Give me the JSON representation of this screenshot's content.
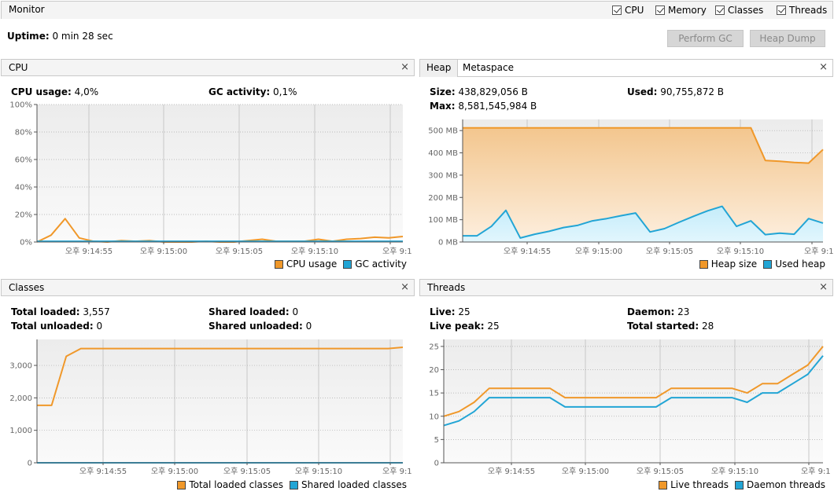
{
  "monitor": {
    "title": "Monitor",
    "checkboxes": [
      {
        "label": "CPU",
        "checked": true
      },
      {
        "label": "Memory",
        "checked": true
      },
      {
        "label": "Classes",
        "checked": true
      },
      {
        "label": "Threads",
        "checked": true
      }
    ],
    "uptime_label": "Uptime:",
    "uptime_value": "0 min 28 sec",
    "buttons": {
      "perform_gc": "Perform GC",
      "heap_dump": "Heap Dump"
    }
  },
  "cpu": {
    "title": "CPU",
    "close": "×",
    "usage_label": "CPU usage:",
    "usage_value": "4,0%",
    "gc_label": "GC activity:",
    "gc_value": "0,1%"
  },
  "heap": {
    "tabs": [
      "Heap",
      "Metaspace"
    ],
    "close": "×",
    "size_label": "Size:",
    "size_value": "438,829,056 B",
    "used_label": "Used:",
    "used_value": "90,755,872 B",
    "max_label": "Max:",
    "max_value": "8,581,545,984 B"
  },
  "classes": {
    "title": "Classes",
    "close": "×",
    "total_loaded_label": "Total loaded:",
    "total_loaded_value": "3,557",
    "total_unloaded_label": "Total unloaded:",
    "total_unloaded_value": "0",
    "shared_loaded_label": "Shared loaded:",
    "shared_loaded_value": "0",
    "shared_unloaded_label": "Shared unloaded:",
    "shared_unloaded_value": "0"
  },
  "threads": {
    "title": "Threads",
    "close": "×",
    "live_label": "Live:",
    "live_value": "25",
    "daemon_label": "Daemon:",
    "daemon_value": "23",
    "live_peak_label": "Live peak:",
    "live_peak_value": "25",
    "total_started_label": "Total started:",
    "total_started_value": "28"
  },
  "colors": {
    "orange": "#f0982a",
    "blue": "#22a5d5"
  },
  "chart_data": [
    {
      "id": "cpu",
      "type": "line",
      "title": "CPU",
      "x_ticks": [
        "오후 9:14:55",
        "오후 9:15:00",
        "오후 9:15:05",
        "오후 9:15:10",
        "오후 9:1"
      ],
      "x_tick_seconds": [
        0,
        5,
        10,
        15,
        20
      ],
      "x_seconds": [
        -3.4,
        -2.4,
        -1.4,
        -0.4,
        0.6,
        1.6,
        2.6,
        3.6,
        4.6,
        5.6,
        6.6,
        7.6,
        8.6,
        9.6,
        10.6,
        11.6,
        12.6,
        13.6,
        14.6,
        15.6,
        16.6,
        17.6,
        18.6,
        19.6,
        20.6
      ],
      "ylim": [
        0,
        100
      ],
      "y_ticks": [
        "0%",
        "20%",
        "40%",
        "60%",
        "80%",
        "100%"
      ],
      "y_tick_values": [
        0,
        20,
        40,
        60,
        80,
        100
      ],
      "series": [
        {
          "name": "CPU usage",
          "color": "#f0982a",
          "values": [
            0,
            5,
            17,
            3,
            0.5,
            0,
            1,
            0.5,
            1,
            0,
            0,
            0,
            0.5,
            0,
            0,
            1,
            2,
            0.5,
            0.5,
            0.5,
            2,
            0.5,
            2,
            2.5,
            3.5,
            3,
            4
          ]
        },
        {
          "name": "GC activity",
          "color": "#22a5d5",
          "values": [
            0.5,
            0.5,
            0.5,
            0.5,
            0.5,
            0.5,
            0.5,
            0.5,
            0.5,
            0.5,
            0.5,
            0.5,
            0.5,
            0.5,
            0.5,
            0.5,
            0.5,
            0.5,
            0.5,
            0.5,
            0.5,
            0.5,
            0.5,
            0.5,
            0.5,
            0.5,
            0.5
          ]
        }
      ],
      "legend": "bottom-right"
    },
    {
      "id": "heap",
      "type": "area",
      "title": "Heap",
      "x_ticks": [
        "오후 9:14:55",
        "오후 9:15:00",
        "오후 9:15:05",
        "오후 9:15:10",
        "오후 9:1"
      ],
      "ylim": [
        0,
        550
      ],
      "y_ticks": [
        "0 MB",
        "100 MB",
        "200 MB",
        "300 MB",
        "400 MB",
        "500 MB"
      ],
      "y_tick_values": [
        0,
        100,
        200,
        300,
        400,
        500
      ],
      "series": [
        {
          "name": "Heap size",
          "color": "#f0982a",
          "values": [
            512,
            512,
            512,
            512,
            512,
            512,
            512,
            512,
            512,
            512,
            512,
            512,
            512,
            512,
            512,
            512,
            512,
            512,
            512,
            512,
            512,
            366,
            362,
            357,
            354,
            415
          ]
        },
        {
          "name": "Used heap",
          "color": "#22a5d5",
          "values": [
            28,
            28,
            70,
            142,
            18,
            35,
            48,
            65,
            75,
            95,
            105,
            118,
            130,
            45,
            60,
            88,
            115,
            140,
            160,
            70,
            95,
            33,
            40,
            35,
            105,
            85
          ]
        }
      ],
      "legend": "bottom-right"
    },
    {
      "id": "classes",
      "type": "line",
      "title": "Classes",
      "x_ticks": [
        "오후 9:14:55",
        "오후 9:15:00",
        "오후 9:15:05",
        "오후 9:15:10",
        "오후 9:1"
      ],
      "ylim": [
        0,
        3800
      ],
      "y_ticks": [
        "0",
        "1,000",
        "2,000",
        "3,000"
      ],
      "y_tick_values": [
        0,
        1000,
        2000,
        3000
      ],
      "series": [
        {
          "name": "Total loaded classes",
          "color": "#f0982a",
          "values": [
            1770,
            1770,
            3280,
            3520,
            3520,
            3520,
            3520,
            3520,
            3520,
            3520,
            3520,
            3520,
            3520,
            3520,
            3520,
            3520,
            3520,
            3520,
            3520,
            3520,
            3520,
            3520,
            3520,
            3520,
            3520,
            3557
          ]
        },
        {
          "name": "Shared loaded classes",
          "color": "#22a5d5",
          "values": [
            0,
            0,
            0,
            0,
            0,
            0,
            0,
            0,
            0,
            0,
            0,
            0,
            0,
            0,
            0,
            0,
            0,
            0,
            0,
            0,
            0,
            0,
            0,
            0,
            0,
            0
          ]
        }
      ],
      "legend": "bottom-right"
    },
    {
      "id": "threads",
      "type": "line",
      "title": "Threads",
      "x_ticks": [
        "오후 9:14:55",
        "오후 9:15:00",
        "오후 9:15:05",
        "오후 9:15:10",
        "오후 9:1"
      ],
      "ylim": [
        0,
        26.5
      ],
      "y_ticks": [
        "0",
        "5",
        "10",
        "15",
        "20",
        "25"
      ],
      "y_tick_values": [
        0,
        5,
        10,
        15,
        20,
        25
      ],
      "series": [
        {
          "name": "Live threads",
          "color": "#f0982a",
          "values": [
            10,
            11,
            13,
            16,
            16,
            16,
            16,
            16,
            14,
            14,
            14,
            14,
            14,
            14,
            14,
            16,
            16,
            16,
            16,
            16,
            15,
            17,
            17,
            19,
            21,
            25
          ]
        },
        {
          "name": "Daemon threads",
          "color": "#22a5d5",
          "values": [
            8,
            9,
            11,
            14,
            14,
            14,
            14,
            14,
            12,
            12,
            12,
            12,
            12,
            12,
            12,
            14,
            14,
            14,
            14,
            14,
            13,
            15,
            15,
            17,
            19,
            23
          ]
        }
      ],
      "legend": "bottom-right"
    }
  ]
}
